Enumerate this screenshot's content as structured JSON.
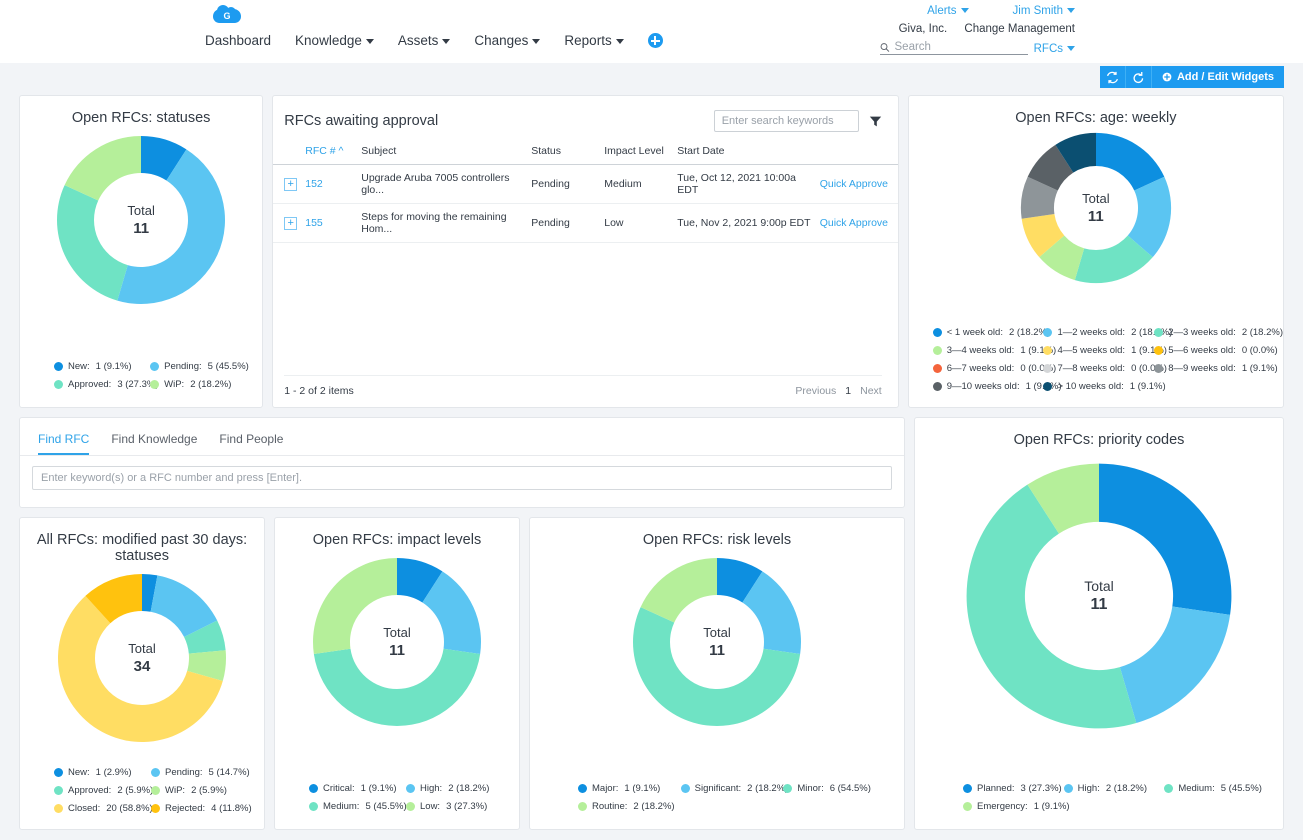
{
  "header": {
    "logo_letter": "G",
    "nav": [
      {
        "label": "Dashboard",
        "has_caret": false
      },
      {
        "label": "Knowledge",
        "has_caret": true
      },
      {
        "label": "Assets",
        "has_caret": true
      },
      {
        "label": "Changes",
        "has_caret": true
      },
      {
        "label": "Reports",
        "has_caret": true
      }
    ],
    "add_icon": "plus-circle-icon",
    "alerts_label": "Alerts",
    "user_label": "Jim Smith",
    "company": "Giva, Inc.",
    "module": "Change Management",
    "search_placeholder": "Search",
    "search_value": "",
    "search_scope": "RFCs",
    "refresh_label": "refresh-icon",
    "reset_label": "reset-icon",
    "add_edit_widgets": "Add / Edit Widgets"
  },
  "widgets": {
    "open_statuses": {
      "title": "Open RFCs: statuses",
      "center_label": "Total",
      "center_value": "11"
    },
    "awaiting": {
      "title": "RFCs awaiting approval",
      "search_placeholder": "Enter search keywords",
      "search_value": "",
      "filter_icon": "filter-icon",
      "columns": [
        "RFC #",
        "Subject",
        "Status",
        "Impact Level",
        "Start Date",
        ""
      ],
      "sort_column": "RFC #",
      "sort_direction": "asc",
      "rows": [
        {
          "expand": "+",
          "rfc": "152",
          "subject": "Upgrade Aruba 7005 controllers glo...",
          "status": "Pending",
          "impact": "Medium",
          "start_date": "Tue, Oct 12, 2021 10:00a EDT",
          "action": "Quick Approve"
        },
        {
          "expand": "+",
          "rfc": "155",
          "subject": "Steps for moving the remaining Hom...",
          "status": "Pending",
          "impact": "Low",
          "start_date": "Tue, Nov 2, 2021 9:00p EDT",
          "action": "Quick Approve"
        }
      ],
      "item_count": "1 - 2 of 2 items",
      "pager": {
        "previous": "Previous",
        "current": "1",
        "next": "Next"
      }
    },
    "age_weekly": {
      "title": "Open RFCs: age: weekly",
      "center_label": "Total",
      "center_value": "11"
    },
    "find": {
      "tabs": [
        {
          "label": "Find RFC",
          "active": true
        },
        {
          "label": "Find Knowledge",
          "active": false
        },
        {
          "label": "Find People",
          "active": false
        }
      ],
      "input_placeholder": "Enter keyword(s) or a RFC number and press [Enter].",
      "input_value": ""
    },
    "priority_codes": {
      "title": "Open RFCs: priority codes",
      "center_label": "Total",
      "center_value": "11"
    },
    "modified_30": {
      "title": "All RFCs: modified past 30 days: statuses",
      "center_label": "Total",
      "center_value": "34"
    },
    "impact_levels": {
      "title": "Open RFCs: impact levels",
      "center_label": "Total",
      "center_value": "11"
    },
    "risk_levels": {
      "title": "Open RFCs: risk levels",
      "center_label": "Total",
      "center_value": "11"
    }
  },
  "chart_data": [
    {
      "id": "open_statuses",
      "type": "pie",
      "title": "Open RFCs: statuses",
      "total": 11,
      "center_label": "Total",
      "legend_position": "bottom",
      "categories": [
        "New",
        "Pending",
        "Approved",
        "WiP"
      ],
      "values": [
        1,
        5,
        3,
        2
      ],
      "percents": [
        "9.1%",
        "45.5%",
        "27.3%",
        "18.2%"
      ],
      "labels": [
        "1 (9.1%)",
        "5 (45.5%)",
        "3 (27.3%)",
        "2 (18.2%)"
      ],
      "colors": [
        "#0d8fe0",
        "#5bc5f2",
        "#6fe3c4",
        "#b5ef9a"
      ]
    },
    {
      "id": "age_weekly",
      "type": "pie",
      "title": "Open RFCs: age: weekly",
      "total": 11,
      "center_label": "Total",
      "legend_position": "bottom",
      "categories": [
        "< 1 week old",
        "1—2 weeks old",
        "2—3 weeks old",
        "3—4 weeks old",
        "4—5 weeks old",
        "5—6 weeks old",
        "6—7 weeks old",
        "7—8 weeks old",
        "8—9 weeks old",
        "9—10 weeks old",
        "> 10 weeks old"
      ],
      "values": [
        2,
        2,
        2,
        1,
        1,
        0,
        0,
        0,
        1,
        1,
        1
      ],
      "percents": [
        "18.2%",
        "18.2%",
        "18.2%",
        "9.1%",
        "9.1%",
        "0.0%",
        "0.0%",
        "0.0%",
        "9.1%",
        "9.1%",
        "9.1%"
      ],
      "labels": [
        "2 (18.2%)",
        "2 (18.2%)",
        "2 (18.2%)",
        "1 (9.1%)",
        "1 (9.1%)",
        "0 (0.0%)",
        "0 (0.0%)",
        "0 (0.0%)",
        "1 (9.1%)",
        "1 (9.1%)",
        "1 (9.1%)"
      ],
      "colors": [
        "#0d8fe0",
        "#5bc5f2",
        "#6fe3c4",
        "#b5ef9a",
        "#ffdd63",
        "#ffc20e",
        "#f4643c",
        "#d4d6d8",
        "#8e9599",
        "#5a6166",
        "#0b4f71"
      ]
    },
    {
      "id": "priority_codes",
      "type": "pie",
      "title": "Open RFCs: priority codes",
      "total": 11,
      "center_label": "Total",
      "legend_position": "bottom",
      "categories": [
        "Planned",
        "High",
        "Medium",
        "Emergency"
      ],
      "values": [
        3,
        2,
        5,
        1
      ],
      "percents": [
        "27.3%",
        "18.2%",
        "45.5%",
        "9.1%"
      ],
      "labels": [
        "3 (27.3%)",
        "2 (18.2%)",
        "5 (45.5%)",
        "1 (9.1%)"
      ],
      "colors": [
        "#0d8fe0",
        "#5bc5f2",
        "#6fe3c4",
        "#b5ef9a"
      ]
    },
    {
      "id": "modified_30",
      "type": "pie",
      "title": "All RFCs: modified past 30 days: statuses",
      "total": 34,
      "center_label": "Total",
      "legend_position": "bottom",
      "categories": [
        "New",
        "Pending",
        "Approved",
        "WiP",
        "Closed",
        "Rejected"
      ],
      "values": [
        1,
        5,
        2,
        2,
        20,
        4
      ],
      "percents": [
        "2.9%",
        "14.7%",
        "5.9%",
        "5.9%",
        "58.8%",
        "11.8%"
      ],
      "labels": [
        "1 (2.9%)",
        "5 (14.7%)",
        "2 (5.9%)",
        "2 (5.9%)",
        "20 (58.8%)",
        "4 (11.8%)"
      ],
      "colors": [
        "#0d8fe0",
        "#5bc5f2",
        "#6fe3c4",
        "#b5ef9a",
        "#ffdd63",
        "#ffc20e"
      ]
    },
    {
      "id": "impact_levels",
      "type": "pie",
      "title": "Open RFCs: impact levels",
      "total": 11,
      "center_label": "Total",
      "legend_position": "bottom",
      "categories": [
        "Critical",
        "High",
        "Medium",
        "Low"
      ],
      "values": [
        1,
        2,
        5,
        3
      ],
      "percents": [
        "9.1%",
        "18.2%",
        "45.5%",
        "27.3%"
      ],
      "labels": [
        "1 (9.1%)",
        "2 (18.2%)",
        "5 (45.5%)",
        "3 (27.3%)"
      ],
      "colors": [
        "#0d8fe0",
        "#5bc5f2",
        "#6fe3c4",
        "#b5ef9a"
      ]
    },
    {
      "id": "risk_levels",
      "type": "pie",
      "title": "Open RFCs: risk levels",
      "total": 11,
      "center_label": "Total",
      "legend_position": "bottom",
      "categories": [
        "Major",
        "Significant",
        "Minor",
        "Routine"
      ],
      "values": [
        1,
        2,
        6,
        2
      ],
      "percents": [
        "9.1%",
        "18.2%",
        "54.5%",
        "18.2%"
      ],
      "labels": [
        "1 (9.1%)",
        "2 (18.2%)",
        "6 (54.5%)",
        "2 (18.2%)"
      ],
      "colors": [
        "#0d8fe0",
        "#5bc5f2",
        "#6fe3c4",
        "#b5ef9a"
      ]
    }
  ]
}
